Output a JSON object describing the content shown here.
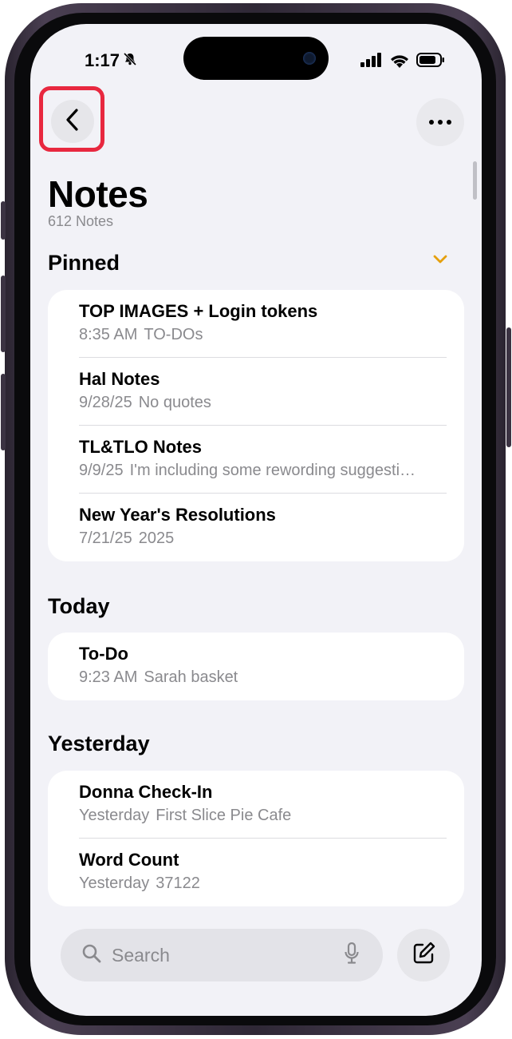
{
  "status": {
    "time": "1:17"
  },
  "header": {
    "title": "Notes",
    "count": "612 Notes"
  },
  "sections": {
    "pinned": {
      "label": "Pinned",
      "notes": [
        {
          "title": "TOP IMAGES + Login tokens",
          "date": "8:35 AM",
          "preview": "TO-DOs"
        },
        {
          "title": "Hal Notes",
          "date": "9/28/25",
          "preview": "No quotes"
        },
        {
          "title": "TL&TLO Notes",
          "date": "9/9/25",
          "preview": "I'm including some rewording suggesti…"
        },
        {
          "title": "New Year's Resolutions",
          "date": "7/21/25",
          "preview": "2025"
        }
      ]
    },
    "today": {
      "label": "Today",
      "notes": [
        {
          "title": "To-Do",
          "date": "9:23 AM",
          "preview": "Sarah basket"
        }
      ]
    },
    "yesterday": {
      "label": "Yesterday",
      "notes": [
        {
          "title": "Donna Check-In",
          "date": "Yesterday",
          "preview": "First Slice Pie Cafe"
        },
        {
          "title": "Word Count",
          "date": "Yesterday",
          "preview": "37122"
        }
      ]
    }
  },
  "search": {
    "placeholder": "Search"
  },
  "colors": {
    "accent": "#e5a00d",
    "highlight": "#e8283f"
  }
}
